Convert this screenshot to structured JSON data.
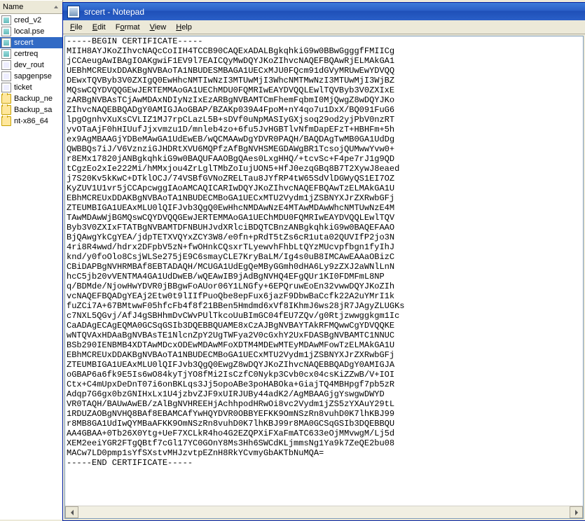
{
  "left": {
    "header": "Name",
    "files": [
      {
        "label": "cred_v2",
        "icon": "cert"
      },
      {
        "label": "local.pse",
        "icon": "cert"
      },
      {
        "label": "srcert",
        "icon": "cert",
        "selected": true
      },
      {
        "label": "certreq",
        "icon": "cert"
      },
      {
        "label": "dev_rout",
        "icon": "doc"
      },
      {
        "label": "sapgenpse",
        "icon": "doc"
      },
      {
        "label": "ticket",
        "icon": "doc"
      },
      {
        "label": "Backup_ne",
        "icon": "folder"
      },
      {
        "label": "Backup_sa",
        "icon": "folder"
      },
      {
        "label": "nt-x86_64",
        "icon": "folder"
      }
    ]
  },
  "notepad": {
    "title": "srcert - Notepad",
    "menu": {
      "file": "File",
      "edit": "Edit",
      "format": "Format",
      "view": "View",
      "help": "Help"
    },
    "content_lines": [
      "-----BEGIN CERTIFICATE-----",
      "MIIH8AYJKoZIhvcNAQcCoIIH4TCCB90CAQExADALBgkqhkiG9w0BBwGgggfFMIICg",
      "jCCAeugAwIBAgIOAKgwiF1EV9l7EAICQyMwDQYJKoZIhvcNAQEFBQAwRjELMAkGA1",
      "UEBhMCREUxDDAKBgNVBAoTA1NBUDESMBAGA1UECxMJU0FQcm91dGVyMRUwEwYDVQQ",
      "DEwxTQVByb3V0ZXIgQ0EwHhcNMTIwNzI3MTUwMjI3WhcNMTMwNzI3MTUwMjI3WjBZ",
      "MQswCQYDVQQGEwJERTEMMAoGA1UEChMDU0FQMRIwEAYDVQQLEwlTQVByb3V0ZXIxE",
      "zARBgNVBAsTCjAwMDAxNDIyNzIxEzARBgNVBAMTCmFhemFqbmI0MjQwgZ8wDQYJKo",
      "ZIhvcNAQEBBQADgY0AMIGJAoGBAP/BZAKp039A4FpoM+nY4qo7u1DxX/BQ091FuG6",
      "lpgOgnhvXuXsCVLIZ1MJ7rpCLazL5B+sDVf0uNpMASIyGXjsoq29od2yjPbV0nzRT",
      "yvOTaAjF0hHIUufJjxvmzu1D/mnleb4zo+6fu5JvHGBTlvNfmDapEFzT+HBHFm+5h",
      "ex9AgMBAAGjYDBeMAwGA1UdEwEB/wQCMAAwDgYDVR0PAQH/BAQDAgTwMB0GA1UdDg",
      "QWBBQs7iJ/V6VznziGJHDRtXVU6MQPfzAfBgNVHSMEGDAWgBR1TcsojQUMwwYvw0+",
      "r8EMx17820jANBgkqhkiG9w0BAQUFAAOBgQAes0LxgHHQ/+tcvSc+F4pe7rJ1g9QD",
      "tCgzEo2xIe222Mi/hMMxjou4ZrLglTMbZoIujUON5+HfJ0ezqGBq8B7T2XywJ8eaed",
      "j7S20Kv5kKwC+DTklOCJ/74VSBfGVNoZRELTau8JYfRP4tW65SdVlDGWyQS1EI7OZ",
      "KyZUV1U1vr5jCCApcwggIAoAMCAQICARIwDQYJKoZIhvcNAQEFBQAwTzELMAkGA1U",
      "EBhMCREUxDDAKBgNVBAoTA1NBUDECMBoGA1UECxMTU2Vydm1jZSBNYXJrZXRwbGFj",
      "ZTEUMBIGA1UEAxMLU0lQIFJvb3QgQ0EwHhcNMDAwNzE4MTAwMDAwWhcNMTUwNzE4M",
      "TAwMDAwWjBGMQswCQYDVQQGEwJERTEMMAoGA1UEChMDU0FQMRIwEAYDVQQLEwlTQV",
      "Byb3V0ZXIxFTATBgNVBAMTDFNBUHJvdXRlciBDQTCBnzANBgkqhkiG9w0BAQEFAAO",
      "BjQAwgYkCgYEA/jdpTETXVQYxZCY3W8/e0fn+pRdT5tZs6cR1uta02QUVIfP2jo3N",
      "4ri8R4wwd/hdrx2DFpbV5zN+fwOHnkCQsxrTLyewvhFhbLtQYzMUcvpfbgn1fyIhJ",
      "knd/y0foOlo8CsjWLSe275jE9C6smayCLE7KryBaLM/Ig4s0uB8IMCAwEAAaOBizC",
      "CBiDAPBgNVHRMBAf8EBTADAQH/MCUGA1UdEgQeMByGGmh0dHA6Ly9zZXJ2aWNlLnN",
      "hcC5jb20vVENTMA4GA1UdDwEB/wQEAwIB9jAdBgNVHQ4EFgQUr1KI0FDMFmL8NP",
      "q/BDMde/NjowHwYDVR0jBBgwFoAUor06Y1LNGfy+6EPQruwEoEn32vwwDQYJKoZIh",
      "vcNAQEFBQADgYEAj2Etw0t9lIIfPuoQbe8epFux6jazF9DbwBaCcfk22A2uYMrI1k",
      "fuZCi7A+67BMtwwF05hfcFb4f8f21BBen5Hmdmd6xVf8IKhmJ6ws28jR7JAgyZLUGKs",
      "c7NXL5QGvj/AfJ4gSBHhmDvCWvPUlTkcoUuBImGC04fEU7ZQv/g0Rtjzwwggkgm1Ic",
      "CaADAgECAgEQMA0GCSqGSIb3DQEBBQUAME8xCzAJBgNVBAYTAkRFMQwwCgYDVQQKE",
      "wNTQVAxHDAaBgNVBAsTE1NlcnZpY2UgTWFya2V0cGxhY2UxFDASBgNVBAMTC1NNUC",
      "BSb290IENBMB4XDTAwMDcxODEwMDAwMFoXDTM4MDEwMTEyMDAwMFowTzELMAkGA1U",
      "EBhMCREUxDDAKBgNVBAoTA1NBUDECMBoGA1UECxMTU2Vydm1jZSBNYXJrZXRwbGFj",
      "ZTEUMBIGA1UEAxMLU0lQIFJvb3QgQ0EwgZ8wDQYJKoZIhvcNAQEBBQADgY0AMIGJA",
      "oGBAP6a6fk9E5Is6wO84kyTjYO8fMi2IsCzfC0Nykp3Cvb0cx04csKiZZwB/V+IOI",
      "Ctx+C4mUpxDeDnT07i6onBKLqs3Jj5opoABe3poHABOka+GiajTQ4MBHpgf7pb5zR",
      "Adqp7G6gx0bzGNIHxLx1U4jzbvZJF9xUIRJUBy44adK2/AgMBAAGjgYswgwDWYD",
      "VR0TAQH/BAUwAwEB/zAlBgNVHREEHjAchhpodHRwOi8vc2Vydm1jZS5zYXAuY29tL",
      "1RDUZAOBgNVHQ8BAf8EBAMCAfYwHQYDVR0OBBYEFKK9OmNSzRn8vuhD0K7lhKBJ99",
      "r8MB8GA1UdIwQYMBaAFKK9OmNSzRn8vuhD0K7lhKBJ99r8MA0GCSqGSIb3DQEBBQU",
      "AA4GBAA+0Tb26X0Ytg+UeF7XCLkR4ho4G2EZQPXiFXaFmATC633eOjMMvwgM/Lj5d",
      "XEM2eeiYGR2FTgQBtf7cGl17YC0GOnY8Ms3Hh6SWCdKLjmmsNg1Ya9k7ZeQE2bu08",
      "MACw7LD0pmp1sYfSXstvMHJzvtpEZnH8RkYCvmyGbAKTbNuMQA=",
      "-----END CERTIFICATE-----"
    ]
  }
}
